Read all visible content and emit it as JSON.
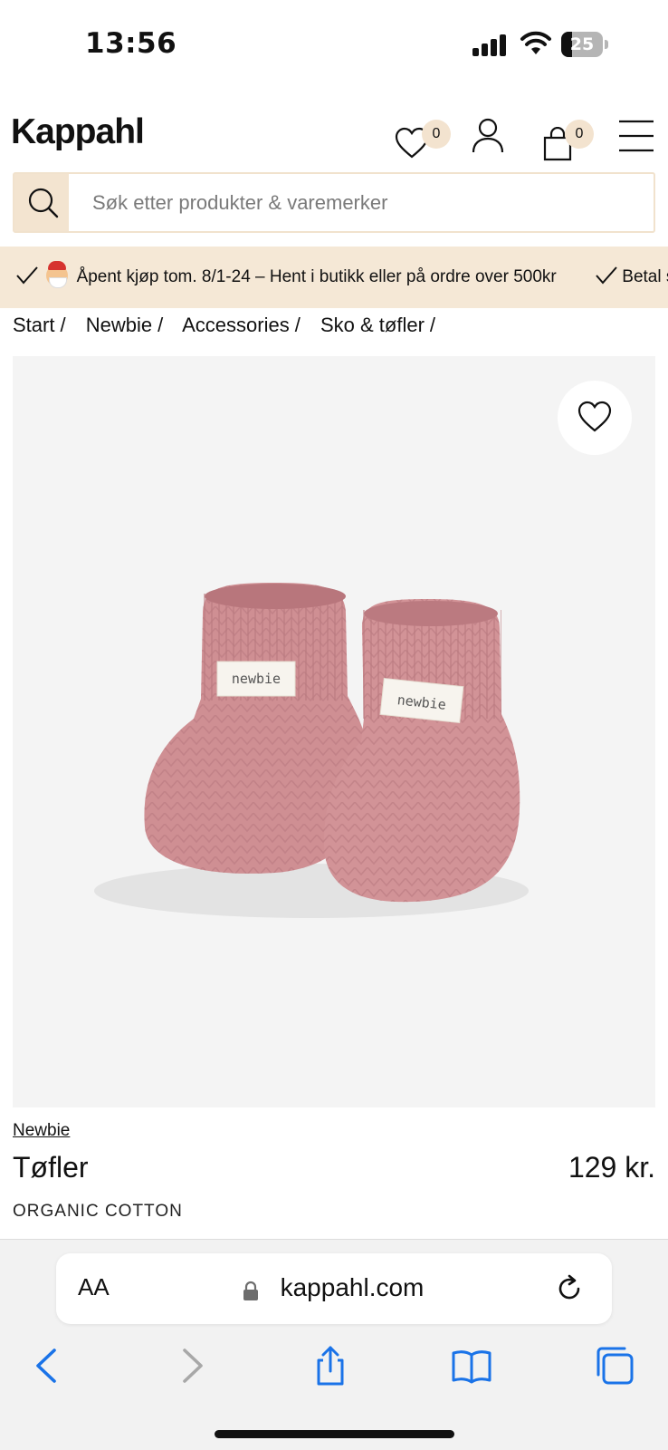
{
  "status_bar": {
    "time": "13:56",
    "battery_level": "25",
    "battery_fraction": 0.25
  },
  "header": {
    "logo": "Kappahl",
    "wishlist_count": "0",
    "cart_count": "0",
    "icons": [
      "heart-icon",
      "user-icon",
      "bag-icon",
      "menu-icon"
    ]
  },
  "search": {
    "placeholder": "Søk etter produkter & varemerker",
    "icon": "search-icon"
  },
  "promo": {
    "items": [
      "Åpent kjøp tom. 8/1-24 – Hent i butikk eller på ordre over 500kr",
      "Betal s"
    ]
  },
  "breadcrumb": {
    "items": [
      "Start",
      "Newbie",
      "Accessories",
      "Sko & tøfler"
    ],
    "separator": "/"
  },
  "product": {
    "image_labels": [
      "newbie",
      "newbie"
    ],
    "brand": "Newbie",
    "name": "Tøfler",
    "price": "129 kr.",
    "tag": "ORGANIC COTTON",
    "colors": {
      "bootie": "#cf8f93",
      "background": "#f4f4f4"
    }
  },
  "browser": {
    "text_size_button": "AA",
    "url": "kappahl.com",
    "icons": [
      "back-icon",
      "forward-icon",
      "share-icon",
      "bookmarks-icon",
      "tabs-icon"
    ],
    "accent_color": "#1a73e8"
  }
}
